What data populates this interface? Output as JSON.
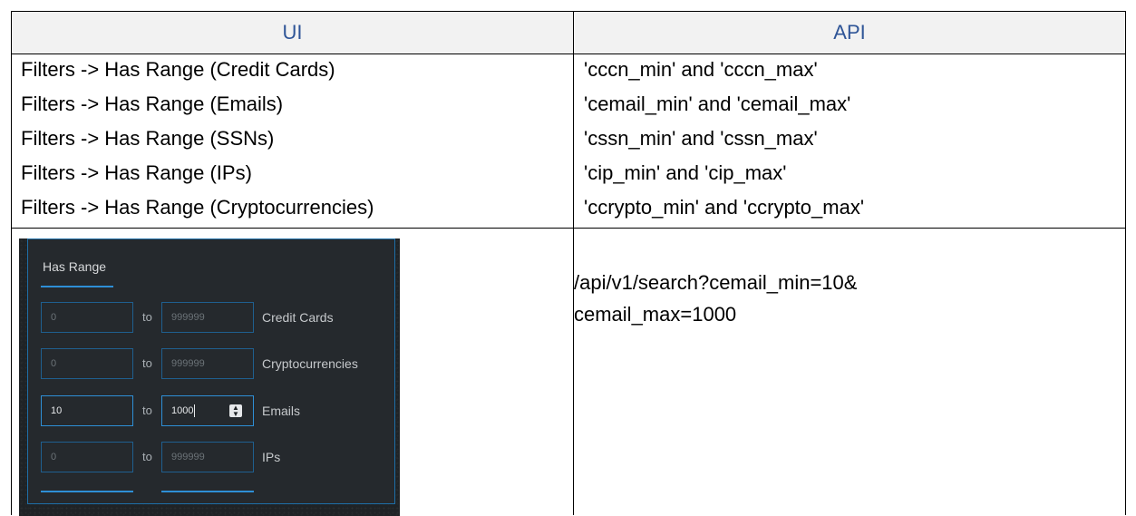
{
  "headers": {
    "ui": "UI",
    "api": "API"
  },
  "rows": [
    {
      "ui": "Filters -> Has Range (Credit Cards)",
      "api": "'cccn_min' and 'cccn_max'"
    },
    {
      "ui": "Filters -> Has Range (Emails)",
      "api": "'cemail_min' and 'cemail_max'"
    },
    {
      "ui": "Filters -> Has Range (SSNs)",
      "api": "'cssn_min' and 'cssn_max'"
    },
    {
      "ui": "Filters -> Has Range (IPs)",
      "api": "'cip_min' and 'cip_max'"
    },
    {
      "ui": "Filters -> Has Range (Cryptocurrencies)",
      "api": "'ccrypto_min' and 'ccrypto_max'"
    }
  ],
  "example": {
    "api_line1": "/api/v1/search?cemail_min=10&",
    "api_line2": "cemail_max=1000",
    "screenshot": {
      "title": "Has Range",
      "to_label": "to",
      "ranges": [
        {
          "min": "0",
          "max": "999999",
          "label": "Credit Cards"
        },
        {
          "min": "0",
          "max": "999999",
          "label": "Cryptocurrencies"
        },
        {
          "min": "10",
          "max": "1000",
          "label": "Emails"
        },
        {
          "min": "0",
          "max": "999999",
          "label": "IPs"
        }
      ],
      "colors": {
        "accent": "#2e8fd6",
        "background": "#25292d",
        "header_text": "#2f5597"
      }
    }
  }
}
